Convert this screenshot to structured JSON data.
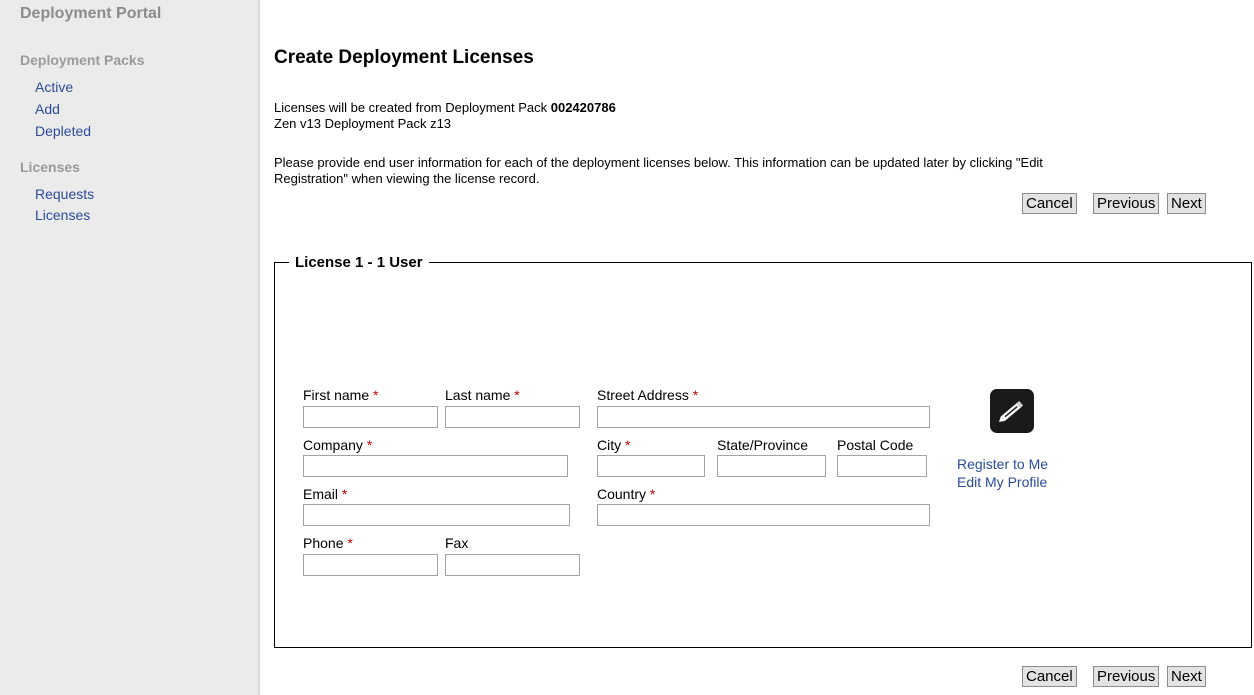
{
  "sidebar": {
    "portal_title": "Deployment Portal",
    "sections": [
      {
        "title": "Deployment Packs",
        "items": [
          "Active",
          "Add",
          "Depleted"
        ]
      },
      {
        "title": "Licenses",
        "items": [
          "Requests",
          "Licenses"
        ]
      }
    ]
  },
  "main": {
    "title": "Create Deployment Licenses",
    "pack_intro": "Licenses will be created from Deployment Pack ",
    "pack_number": "002420786",
    "pack_name": "Zen v13 Deployment Pack z13",
    "instructions_line1": "Please provide end user information for each of the deployment licenses below. This information can be updated later by clicking \"Edit",
    "instructions_line2": "Registration\" when viewing the license record.",
    "buttons": {
      "cancel": "Cancel",
      "previous": "Previous",
      "next": "Next"
    }
  },
  "license": {
    "legend": "License 1 - 1 User",
    "required_marker": "*",
    "labels": {
      "first_name": "First name",
      "last_name": "Last name",
      "street_address": "Street Address",
      "company": "Company",
      "city": "City",
      "state": "State/Province",
      "postal_code": "Postal Code",
      "email": "Email",
      "country": "Country",
      "phone": "Phone",
      "fax": "Fax"
    },
    "values": {
      "first_name": "",
      "last_name": "",
      "street_address": "",
      "company": "",
      "city": "",
      "state": "",
      "postal_code": "",
      "email": "",
      "country": "",
      "phone": "",
      "fax": ""
    },
    "links": {
      "register_to_me": "Register to Me",
      "edit_my_profile": "Edit My Profile"
    },
    "icon": "edit-pencil-icon"
  },
  "colors": {
    "link": "#2b4c9a",
    "required": "#cc0000",
    "sidebar_bg": "#ebebeb"
  }
}
